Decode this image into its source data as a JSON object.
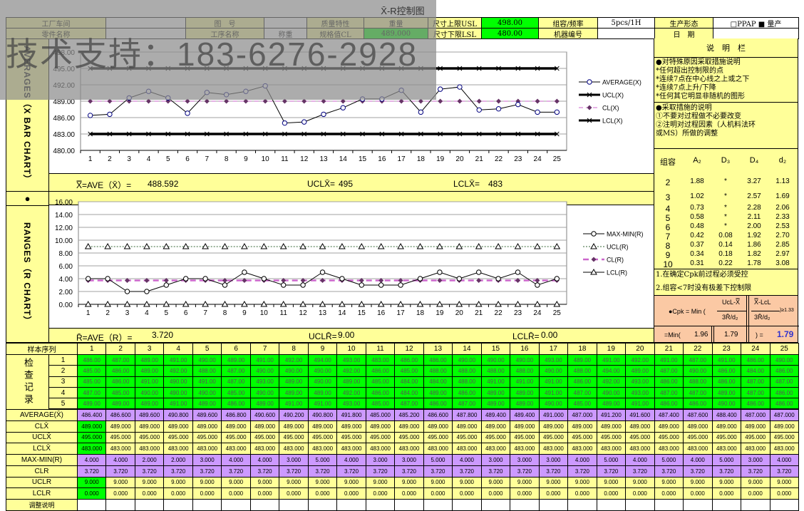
{
  "watermark": "技术支持：183-6276-2928",
  "title": "X̄-R控制图",
  "header": {
    "row1": [
      "工厂车间",
      "",
      "图　号",
      "",
      "质量特性",
      "重量",
      "尺寸上限USL",
      "498.00",
      "组容/频率",
      "5pcs/1H",
      "生产形态",
      "□PPAP  ■ 量产"
    ],
    "row2": [
      "零件名称",
      "",
      "工序名称",
      "称重",
      "规格值CL",
      "489.000",
      "尺寸下限LSL",
      "480.00",
      "机器编号",
      "",
      "日　期",
      ""
    ]
  },
  "side_labels": {
    "xbar": "AVERAGES（X BAR CHART）",
    "dot": "●",
    "r": "RANGES（R CHART）"
  },
  "xbar_summary": {
    "ave_label": "X̿=AVE（X̄）=",
    "ave": "488.592",
    "ucl_label": "UCLX̄=",
    "ucl": "495",
    "lcl_label": "LCLX̄=",
    "lcl": "483"
  },
  "r_summary": {
    "ave_label": "R̄=AVE（R）=",
    "ave": "3.720",
    "ucl_label": "UCLR̄=",
    "ucl": "9.00",
    "lcl_label": "LCLR̄=",
    "lcl": "0.00"
  },
  "panel": {
    "title": "说　明　栏",
    "section1": [
      "●对特殊原因采取措施说明",
      "*任何超出控制限的点",
      "*连续7点在中心线之上或之下",
      "*连续7点上升/下降",
      "*任何其它明显非随机的图形"
    ],
    "section2": [
      "●采取措施的说明",
      "①不要对过程做不必要改变",
      "②注明对过程因素（人机料法环",
      "或MS）所做的调整"
    ],
    "constants": {
      "headers": [
        "组容",
        "A₂",
        "D₃",
        "D₄",
        "d₂"
      ],
      "rows": [
        [
          "2",
          "1.88",
          "*",
          "3.27",
          "1.13"
        ],
        [
          "3",
          "1.02",
          "*",
          "2.57",
          "1.69"
        ],
        [
          "4",
          "0.73",
          "*",
          "2.28",
          "2.06"
        ],
        [
          "5",
          "0.58",
          "*",
          "2.11",
          "2.33"
        ],
        [
          "6",
          "0.48",
          "*",
          "2.00",
          "2.53"
        ],
        [
          "7",
          "0.42",
          "0.08",
          "1.92",
          "2.70"
        ],
        [
          "8",
          "0.37",
          "0.14",
          "1.86",
          "2.85"
        ],
        [
          "9",
          "0.34",
          "0.18",
          "1.82",
          "2.97"
        ],
        [
          "10",
          "0.31",
          "0.22",
          "1.78",
          "3.08"
        ]
      ]
    },
    "notes": [
      "1.在确定Cpk前过程必须受控",
      "2.组容<7时没有极差下控制限"
    ],
    "cpk": {
      "formula_label": "●Cpk = Min (",
      "num1": "UcL-X̿",
      "den1": "3R̄/d₂",
      "num2": "X̿-LcL",
      "den2": "3R̄/d₂",
      "cond": ")≥1.33",
      "min_label": "=Min(",
      "v1": "1.96",
      "v2": "1.79",
      "eq": ")  =",
      "result": "1.79"
    }
  },
  "table": {
    "seq_label": "样本序列",
    "record_label": "检查记录",
    "columns": [
      "1",
      "2",
      "3",
      "4",
      "5",
      "6",
      "7",
      "8",
      "9",
      "10",
      "11",
      "12",
      "13",
      "14",
      "15",
      "16",
      "17",
      "18",
      "19",
      "20",
      "21",
      "22",
      "23",
      "24",
      "25"
    ],
    "samples": [
      {
        "label": "1",
        "values": [
          "486.00",
          "487.00",
          "489.00",
          "491.00",
          "490.00",
          "489.00",
          "491.00",
          "492.00",
          "494.00",
          "493.00",
          "483.00",
          "486.00",
          "486.00",
          "490.00",
          "490.00",
          "490.00",
          "493.00",
          "489.00",
          "491.00",
          "492.00",
          "491.00",
          "487.00",
          "491.00",
          "486.00",
          "490.00"
        ]
      },
      {
        "label": "2",
        "values": [
          "485.00",
          "486.00",
          "489.00",
          "492.00",
          "488.00",
          "487.00",
          "490.00",
          "490.00",
          "490.00",
          "492.00",
          "486.00",
          "485.00",
          "488.00",
          "488.00",
          "488.00",
          "488.00",
          "490.00",
          "488.00",
          "494.00",
          "489.00",
          "487.00",
          "490.00",
          "486.00",
          "484.00",
          "486.00"
        ]
      },
      {
        "label": "3",
        "values": [
          "485.00",
          "486.00",
          "491.00",
          "490.00",
          "491.00",
          "487.00",
          "493.00",
          "489.00",
          "490.00",
          "489.00",
          "485.00",
          "484.00",
          "484.00",
          "488.00",
          "491.00",
          "491.00",
          "491.00",
          "486.00",
          "492.00",
          "493.00",
          "486.00",
          "488.00",
          "486.00",
          "487.00",
          "487.00"
        ]
      },
      {
        "label": "4",
        "values": [
          "487.00",
          "485.00",
          "490.00",
          "490.00",
          "490.00",
          "485.00",
          "490.00",
          "489.00",
          "489.00",
          "492.00",
          "486.00",
          "484.00",
          "489.00",
          "486.00",
          "489.00",
          "489.00",
          "491.00",
          "487.00",
          "490.00",
          "493.00",
          "487.00",
          "487.00",
          "489.00",
          "487.00",
          "486.00"
        ]
      },
      {
        "label": "5",
        "values": [
          "489.00",
          "489.00",
          "489.00",
          "491.00",
          "489.00",
          "486.00",
          "489.00",
          "491.00",
          "491.00",
          "493.00",
          "485.00",
          "487.00",
          "486.00",
          "487.00",
          "489.00",
          "489.00",
          "490.00",
          "485.00",
          "489.00",
          "491.00",
          "486.00",
          "486.00",
          "490.00",
          "486.00",
          "486.00"
        ]
      }
    ],
    "derived": [
      {
        "label": "AVERAGE(X̄)",
        "style": "p",
        "values": [
          "486.400",
          "486.600",
          "489.600",
          "490.800",
          "489.600",
          "486.800",
          "490.600",
          "490.200",
          "490.800",
          "491.800",
          "485.000",
          "485.200",
          "486.600",
          "487.800",
          "489.400",
          "489.400",
          "491.000",
          "487.000",
          "491.200",
          "491.600",
          "487.400",
          "487.600",
          "488.400",
          "487.000",
          "487.000"
        ]
      },
      {
        "label": "CLX̄",
        "style": "y",
        "values": [
          "489.000",
          "489.000",
          "489.000",
          "489.000",
          "489.000",
          "489.000",
          "489.000",
          "489.000",
          "489.000",
          "489.000",
          "489.000",
          "489.000",
          "489.000",
          "489.000",
          "489.000",
          "489.000",
          "489.000",
          "489.000",
          "489.000",
          "489.000",
          "489.000",
          "489.000",
          "489.000",
          "489.000",
          "489.000"
        ]
      },
      {
        "label": "UCLX̄",
        "style": "y",
        "values": [
          "495.000",
          "495.000",
          "495.000",
          "495.000",
          "495.000",
          "495.000",
          "495.000",
          "495.000",
          "495.000",
          "495.000",
          "495.000",
          "495.000",
          "495.000",
          "495.000",
          "495.000",
          "495.000",
          "495.000",
          "495.000",
          "495.000",
          "495.000",
          "495.000",
          "495.000",
          "495.000",
          "495.000",
          "495.000"
        ]
      },
      {
        "label": "LCLX̄",
        "style": "y",
        "values": [
          "483.000",
          "483.000",
          "483.000",
          "483.000",
          "483.000",
          "483.000",
          "483.000",
          "483.000",
          "483.000",
          "483.000",
          "483.000",
          "483.000",
          "483.000",
          "483.000",
          "483.000",
          "483.000",
          "483.000",
          "483.000",
          "483.000",
          "483.000",
          "483.000",
          "483.000",
          "483.000",
          "483.000",
          "483.000"
        ]
      },
      {
        "label": "MAX-MIN(R)",
        "style": "p",
        "values": [
          "4.000",
          "4.000",
          "2.000",
          "2.000",
          "3.000",
          "4.000",
          "4.000",
          "3.000",
          "5.000",
          "4.000",
          "3.000",
          "3.000",
          "5.000",
          "4.000",
          "3.000",
          "3.000",
          "3.000",
          "4.000",
          "5.000",
          "4.000",
          "5.000",
          "4.000",
          "5.000",
          "3.000",
          "4.000"
        ]
      },
      {
        "label": "CLR",
        "style": "p",
        "values": [
          "3.720",
          "3.720",
          "3.720",
          "3.720",
          "3.720",
          "3.720",
          "3.720",
          "3.720",
          "3.720",
          "3.720",
          "3.720",
          "3.720",
          "3.720",
          "3.720",
          "3.720",
          "3.720",
          "3.720",
          "3.720",
          "3.720",
          "3.720",
          "3.720",
          "3.720",
          "3.720",
          "3.720",
          "3.720"
        ]
      },
      {
        "label": "UCLR",
        "style": "y",
        "values": [
          "9.000",
          "9.000",
          "9.000",
          "9.000",
          "9.000",
          "9.000",
          "9.000",
          "9.000",
          "9.000",
          "9.000",
          "9.000",
          "9.000",
          "9.000",
          "9.000",
          "9.000",
          "9.000",
          "9.000",
          "9.000",
          "9.000",
          "9.000",
          "9.000",
          "9.000",
          "9.000",
          "9.000",
          "9.000"
        ]
      },
      {
        "label": "LCLR",
        "style": "y",
        "values": [
          "0.000",
          "0.000",
          "0.000",
          "0.000",
          "0.000",
          "0.000",
          "0.000",
          "0.000",
          "0.000",
          "0.000",
          "0.000",
          "0.000",
          "0.000",
          "0.000",
          "0.000",
          "0.000",
          "0.000",
          "0.000",
          "0.000",
          "0.000",
          "0.000",
          "0.000",
          "0.000",
          "0.000",
          "0.000"
        ]
      },
      {
        "label": "调整说明",
        "style": "w",
        "values": [
          "",
          "",
          "",
          "",
          "",
          "",
          "",
          "",
          "",
          "",
          "",
          "",
          "",
          "",
          "",
          "",
          "",
          "",
          "",
          "",
          "",
          "",
          "",
          "",
          ""
        ]
      }
    ]
  },
  "chart_data": [
    {
      "type": "line",
      "title": "",
      "categories": [
        "1",
        "2",
        "3",
        "4",
        "5",
        "6",
        "7",
        "8",
        "9",
        "10",
        "11",
        "12",
        "13",
        "14",
        "15",
        "16",
        "17",
        "18",
        "19",
        "20",
        "21",
        "22",
        "23",
        "24",
        "25"
      ],
      "ylim": [
        480,
        498
      ],
      "yticks": [
        "480.00",
        "483.00",
        "486.00",
        "489.00",
        "492.00",
        "495.00",
        "498.00"
      ],
      "grid": true,
      "legend": "right",
      "series": [
        {
          "name": "AVERAGE(X)",
          "marker": "circle",
          "color": "#000080",
          "values": [
            486.4,
            486.6,
            489.6,
            490.8,
            489.6,
            486.8,
            490.6,
            490.2,
            490.8,
            491.8,
            485.0,
            485.2,
            486.6,
            487.8,
            489.4,
            489.4,
            491.0,
            487.0,
            491.2,
            491.6,
            487.4,
            487.6,
            488.4,
            487.0,
            487.0
          ]
        },
        {
          "name": "UCL(X)",
          "marker": "x",
          "color": "#000000",
          "values": [
            495,
            495,
            495,
            495,
            495,
            495,
            495,
            495,
            495,
            495,
            495,
            495,
            495,
            495,
            495,
            495,
            495,
            495,
            495,
            495,
            495,
            495,
            495,
            495,
            495
          ]
        },
        {
          "name": "CL(X)",
          "marker": "diamond",
          "color": "#993399",
          "values": [
            489,
            489,
            489,
            489,
            489,
            489,
            489,
            489,
            489,
            489,
            489,
            489,
            489,
            489,
            489,
            489,
            489,
            489,
            489,
            489,
            489,
            489,
            489,
            489,
            489
          ]
        },
        {
          "name": "LCL(X)",
          "marker": "x",
          "color": "#000000",
          "values": [
            483,
            483,
            483,
            483,
            483,
            483,
            483,
            483,
            483,
            483,
            483,
            483,
            483,
            483,
            483,
            483,
            483,
            483,
            483,
            483,
            483,
            483,
            483,
            483,
            483
          ]
        }
      ]
    },
    {
      "type": "line",
      "title": "",
      "categories": [
        "1",
        "2",
        "3",
        "4",
        "5",
        "6",
        "7",
        "8",
        "9",
        "10",
        "11",
        "12",
        "13",
        "14",
        "15",
        "16",
        "17",
        "18",
        "19",
        "20",
        "21",
        "22",
        "23",
        "24",
        "25"
      ],
      "ylim": [
        0,
        16
      ],
      "yticks": [
        "0.00",
        "2.00",
        "4.00",
        "6.00",
        "8.00",
        "10.00",
        "12.00",
        "14.00",
        "16.00"
      ],
      "grid": true,
      "legend": "right",
      "series": [
        {
          "name": "MAX-MIN(R)",
          "marker": "circle",
          "color": "#000000",
          "values": [
            4,
            4,
            2,
            2,
            3,
            4,
            4,
            3,
            5,
            4,
            3,
            3,
            5,
            4,
            3,
            3,
            3,
            4,
            5,
            4,
            5,
            4,
            5,
            3,
            4
          ]
        },
        {
          "name": "UCL(R)",
          "marker": "triangle",
          "color": "#336633",
          "values": [
            9,
            9,
            9,
            9,
            9,
            9,
            9,
            9,
            9,
            9,
            9,
            9,
            9,
            9,
            9,
            9,
            9,
            9,
            9,
            9,
            9,
            9,
            9,
            9,
            9
          ]
        },
        {
          "name": "CL(R)",
          "marker": "diamond",
          "color": "#993399",
          "values": [
            3.72,
            3.72,
            3.72,
            3.72,
            3.72,
            3.72,
            3.72,
            3.72,
            3.72,
            3.72,
            3.72,
            3.72,
            3.72,
            3.72,
            3.72,
            3.72,
            3.72,
            3.72,
            3.72,
            3.72,
            3.72,
            3.72,
            3.72,
            3.72,
            3.72
          ]
        },
        {
          "name": "LCL(R)",
          "marker": "triangle",
          "color": "#000000",
          "values": [
            0,
            0,
            0,
            0,
            0,
            0,
            0,
            0,
            0,
            0,
            0,
            0,
            0,
            0,
            0,
            0,
            0,
            0,
            0,
            0,
            0,
            0,
            0,
            0,
            0
          ]
        }
      ]
    }
  ]
}
